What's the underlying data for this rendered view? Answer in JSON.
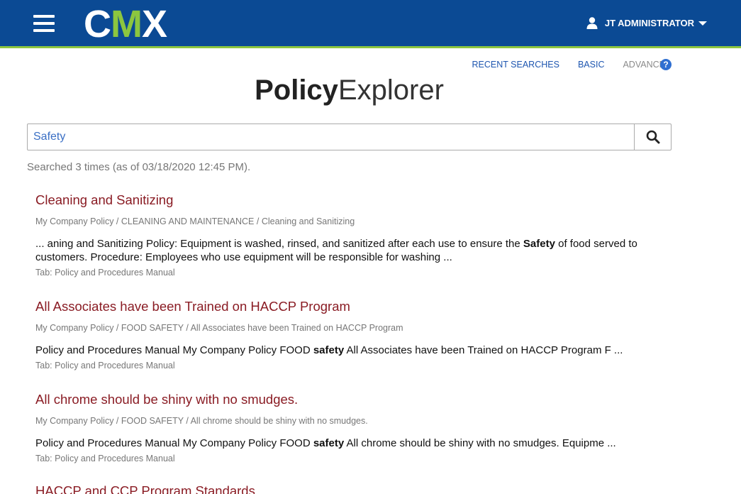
{
  "header": {
    "menu_icon": "hamburger-menu-icon",
    "logo": {
      "c": "C",
      "m": "M",
      "x": "X"
    },
    "user_icon": "user-icon",
    "user_name": "JT ADMINISTRATOR",
    "colors": {
      "bar": "#0b4a94",
      "accent": "#8cc63f"
    }
  },
  "toplinks": {
    "recent": "RECENT SEARCHES",
    "basic": "BASIC",
    "advanced": "ADVANCED",
    "help": "?"
  },
  "title": {
    "bold": "Policy",
    "light": "Explorer"
  },
  "search": {
    "value": "Safety",
    "button_icon": "search-icon"
  },
  "meta": "Searched 3 times (as of 03/18/2020 12:45 PM).",
  "results": [
    {
      "title": "Cleaning and Sanitizing",
      "crumb": "My Company Policy / CLEANING AND MAINTENANCE / Cleaning and Sanitizing",
      "snippet_pre": "... aning and Sanitizing Policy: Equipment is washed, rinsed, and sanitized after each use to ensure the ",
      "snippet_bold": "Safety",
      "snippet_post": " of food served to customers. Procedure: Employees who use equipment will be responsible for washing ...",
      "tab": "Tab: Policy and Procedures Manual"
    },
    {
      "title": "All Associates have been Trained on HACCP Program",
      "crumb": "My Company Policy / FOOD SAFETY / All Associates have been Trained on HACCP Program",
      "snippet_pre": "Policy and Procedures Manual My Company Policy FOOD ",
      "snippet_bold": "safety",
      "snippet_post": " All Associates have been Trained on HACCP Program F ...",
      "tab": "Tab: Policy and Procedures Manual"
    },
    {
      "title": "All chrome should be shiny with no smudges.",
      "crumb": "My Company Policy / FOOD SAFETY / All chrome should be shiny with no smudges.",
      "snippet_pre": "Policy and Procedures Manual My Company Policy FOOD ",
      "snippet_bold": "safety",
      "snippet_post": " All chrome should be shiny with no smudges. Equipme ...",
      "tab": "Tab: Policy and Procedures Manual"
    },
    {
      "title": "HACCP and CCP Program Standards"
    }
  ]
}
